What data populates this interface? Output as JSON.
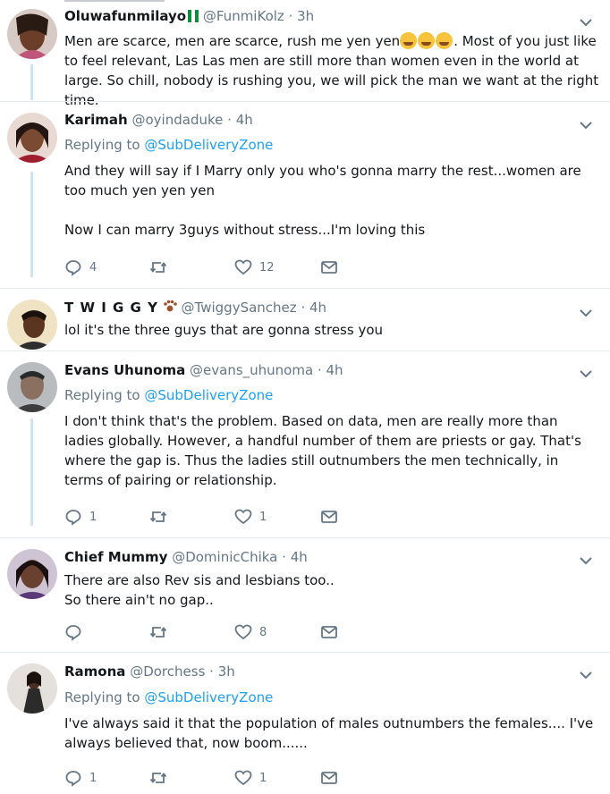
{
  "tweets": [
    {
      "name": "Oluwafunmilayo",
      "handle": "@FunmiKolz",
      "time": "3h",
      "text_before_emoji": "Men are scarce, men are scarce, rush me yen yen",
      "text_after_emoji": ". Most of you just like to feel relevant, Las Las men are still more than women even in the world at large. So chill, nobody is rushing you, we will pick the man we want at the right time.",
      "emoji": "rolling-on-floor-laughing x3"
    },
    {
      "name": "Karimah",
      "handle": "@oyindaduke",
      "time": "4h",
      "replying_prefix": "Replying to",
      "replying_to": "@SubDeliveryZone",
      "paragraphs": [
        "And they will say if I Marry only you who's gonna marry the rest...women are too much yen yen yen",
        "Now I can marry 3guys without stress...I'm loving this"
      ],
      "replies": "4",
      "retweets": "",
      "likes": "12"
    },
    {
      "name": "T W I G G Y",
      "handle": "@TwiggySanchez",
      "time": "4h",
      "paragraphs": [
        "lol it's the three guys that are gonna stress you"
      ]
    },
    {
      "name": "Evans Uhunoma",
      "handle": "@evans_uhunoma",
      "time": "4h",
      "replying_prefix": "Replying to",
      "replying_to": "@SubDeliveryZone",
      "paragraphs": [
        "I don't think that's the problem. Based on data, men are really more than ladies globally. However, a handful number of them are priests or gay. That's where the gap is. Thus the ladies still outnumbers the men technically, in terms of pairing or relationship."
      ],
      "replies": "1",
      "retweets": "",
      "likes": "1"
    },
    {
      "name": "Chief Mummy",
      "handle": "@DominicChika",
      "time": "4h",
      "paragraphs": [
        "There are also Rev sis and lesbians too..",
        "So there ain't no gap.."
      ],
      "replies": "",
      "retweets": "",
      "likes": "8"
    },
    {
      "name": "Ramona",
      "handle": "@Dorchess",
      "time": "3h",
      "replying_prefix": "Replying to",
      "replying_to": "@SubDeliveryZone",
      "paragraphs": [
        "I've always said it that the population of males outnumbers the females.... I've always believed that, now boom......"
      ],
      "replies": "1",
      "retweets": "",
      "likes": "1"
    }
  ],
  "colors": {
    "link": "#1da1f2",
    "muted": "#657786",
    "divider": "#e6ecf0",
    "thread_line": "#cfe3f4"
  },
  "icons": [
    "reply-icon",
    "retweet-icon",
    "like-icon",
    "direct-message-icon",
    "chevron-down-icon",
    "paw-icon",
    "nigeria-flag-icon"
  ]
}
